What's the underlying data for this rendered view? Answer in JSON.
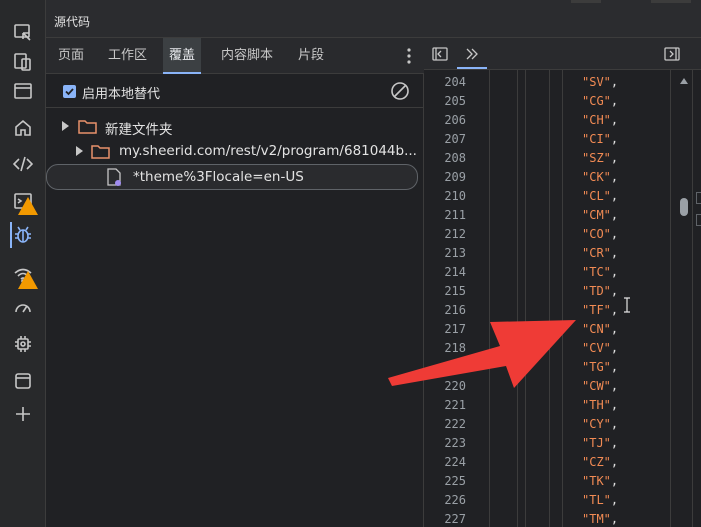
{
  "window": {
    "title": "源代码"
  },
  "navigator": {
    "tabs": [
      {
        "label": "页面"
      },
      {
        "label": "工作区"
      },
      {
        "label": "覆盖"
      },
      {
        "label": "内容脚本"
      },
      {
        "label": "片段"
      }
    ],
    "active_tab": "覆盖",
    "enable_local_overrides": {
      "label": "启用本地替代",
      "checked": true
    },
    "tree": [
      {
        "label": "新建文件夹",
        "type": "folder"
      },
      {
        "label": "my.sheerid.com/rest/v2/program/681044b...",
        "type": "folder"
      },
      {
        "label": "*theme%3Flocale=en-US",
        "type": "file"
      }
    ]
  },
  "editor": {
    "lines": [
      {
        "no": "204",
        "code": "\"SV\""
      },
      {
        "no": "205",
        "code": "\"CG\""
      },
      {
        "no": "206",
        "code": "\"CH\""
      },
      {
        "no": "207",
        "code": "\"CI\""
      },
      {
        "no": "208",
        "code": "\"SZ\""
      },
      {
        "no": "209",
        "code": "\"CK\""
      },
      {
        "no": "210",
        "code": "\"CL\""
      },
      {
        "no": "211",
        "code": "\"CM\""
      },
      {
        "no": "212",
        "code": "\"CO\""
      },
      {
        "no": "213",
        "code": "\"CR\""
      },
      {
        "no": "214",
        "code": "\"TC\""
      },
      {
        "no": "215",
        "code": "\"TD\""
      },
      {
        "no": "216",
        "code": "\"TF\""
      },
      {
        "no": "217",
        "code": "\"CN\""
      },
      {
        "no": "218",
        "code": "\"CV\""
      },
      {
        "no": "219",
        "code": "\"TG\""
      },
      {
        "no": "220",
        "code": "\"CW\""
      },
      {
        "no": "221",
        "code": "\"TH\""
      },
      {
        "no": "222",
        "code": "\"CY\""
      },
      {
        "no": "223",
        "code": "\"TJ\""
      },
      {
        "no": "224",
        "code": "\"CZ\""
      },
      {
        "no": "225",
        "code": "\"TK\""
      },
      {
        "no": "226",
        "code": "\"TL\""
      },
      {
        "no": "227",
        "code": "\"TM\""
      }
    ]
  },
  "colors": {
    "accent": "#8ab4f8",
    "string": "#f28b54",
    "warning": "#f29900",
    "arrow": "#ef3b36",
    "folder": "#e8916b"
  }
}
